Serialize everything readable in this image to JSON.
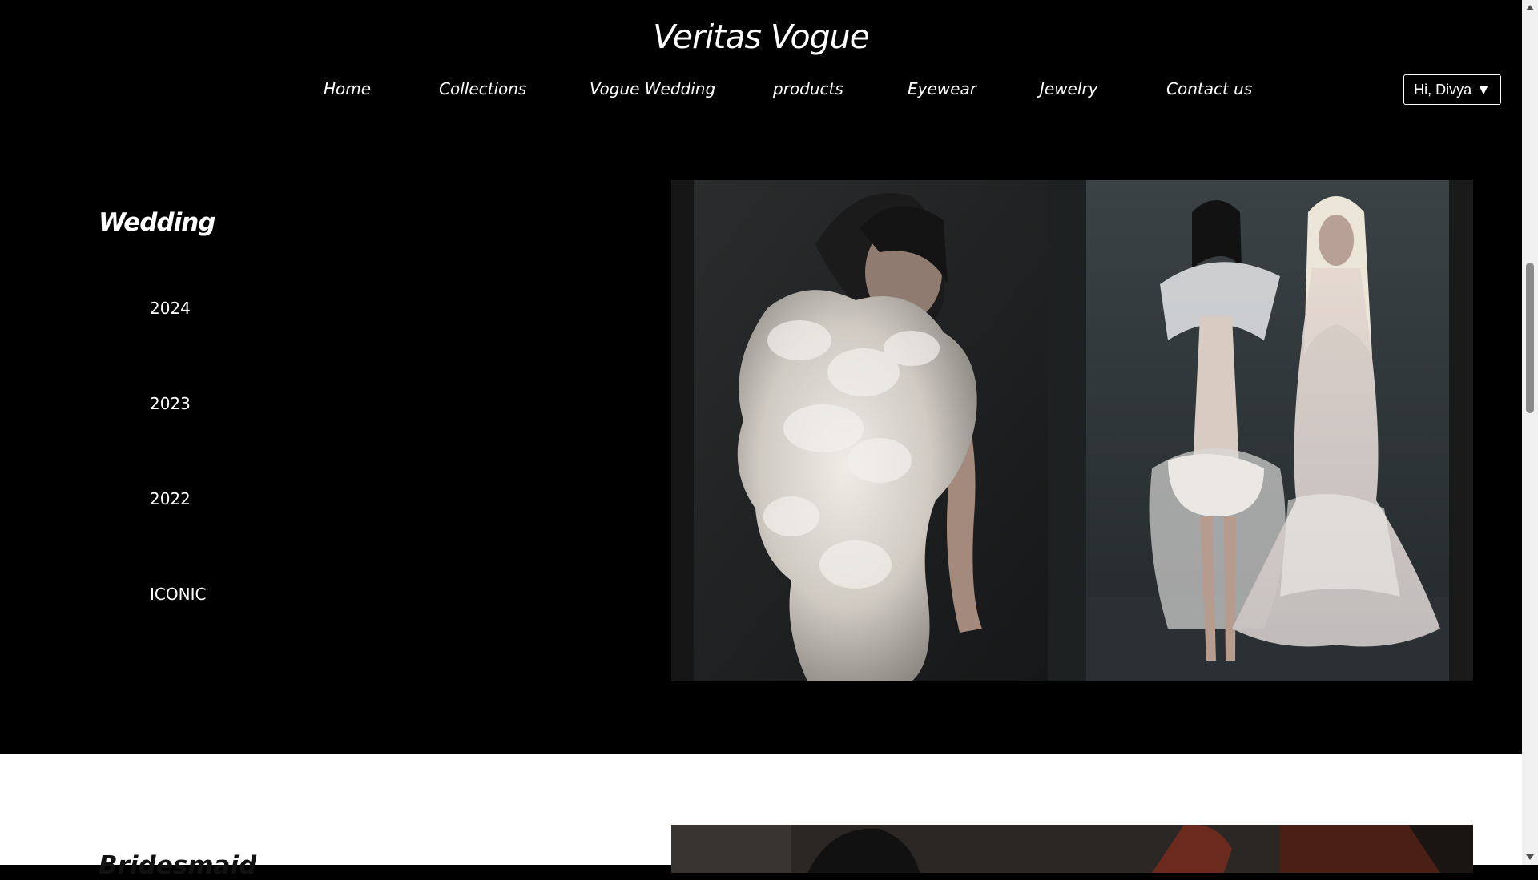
{
  "site": {
    "brand": "Veritas Vogue"
  },
  "nav": {
    "items": [
      {
        "label": "Home"
      },
      {
        "label": "Collections"
      },
      {
        "label": "Vogue Wedding"
      },
      {
        "label": "products"
      },
      {
        "label": "Eyewear"
      },
      {
        "label": "Jewelry"
      },
      {
        "label": "Contact us"
      }
    ]
  },
  "user_menu": {
    "label": "Hi, Divya",
    "caret": "▼"
  },
  "wedding": {
    "title": "Wedding",
    "years": [
      {
        "label": "2024"
      },
      {
        "label": "2023"
      },
      {
        "label": "2022"
      },
      {
        "label": "ICONIC"
      }
    ]
  },
  "bridesmaid": {
    "title": "Bridesmaid"
  },
  "colors": {
    "header_bg": "#000000",
    "text": "#ffffff",
    "light_section_bg": "#ffffff"
  }
}
